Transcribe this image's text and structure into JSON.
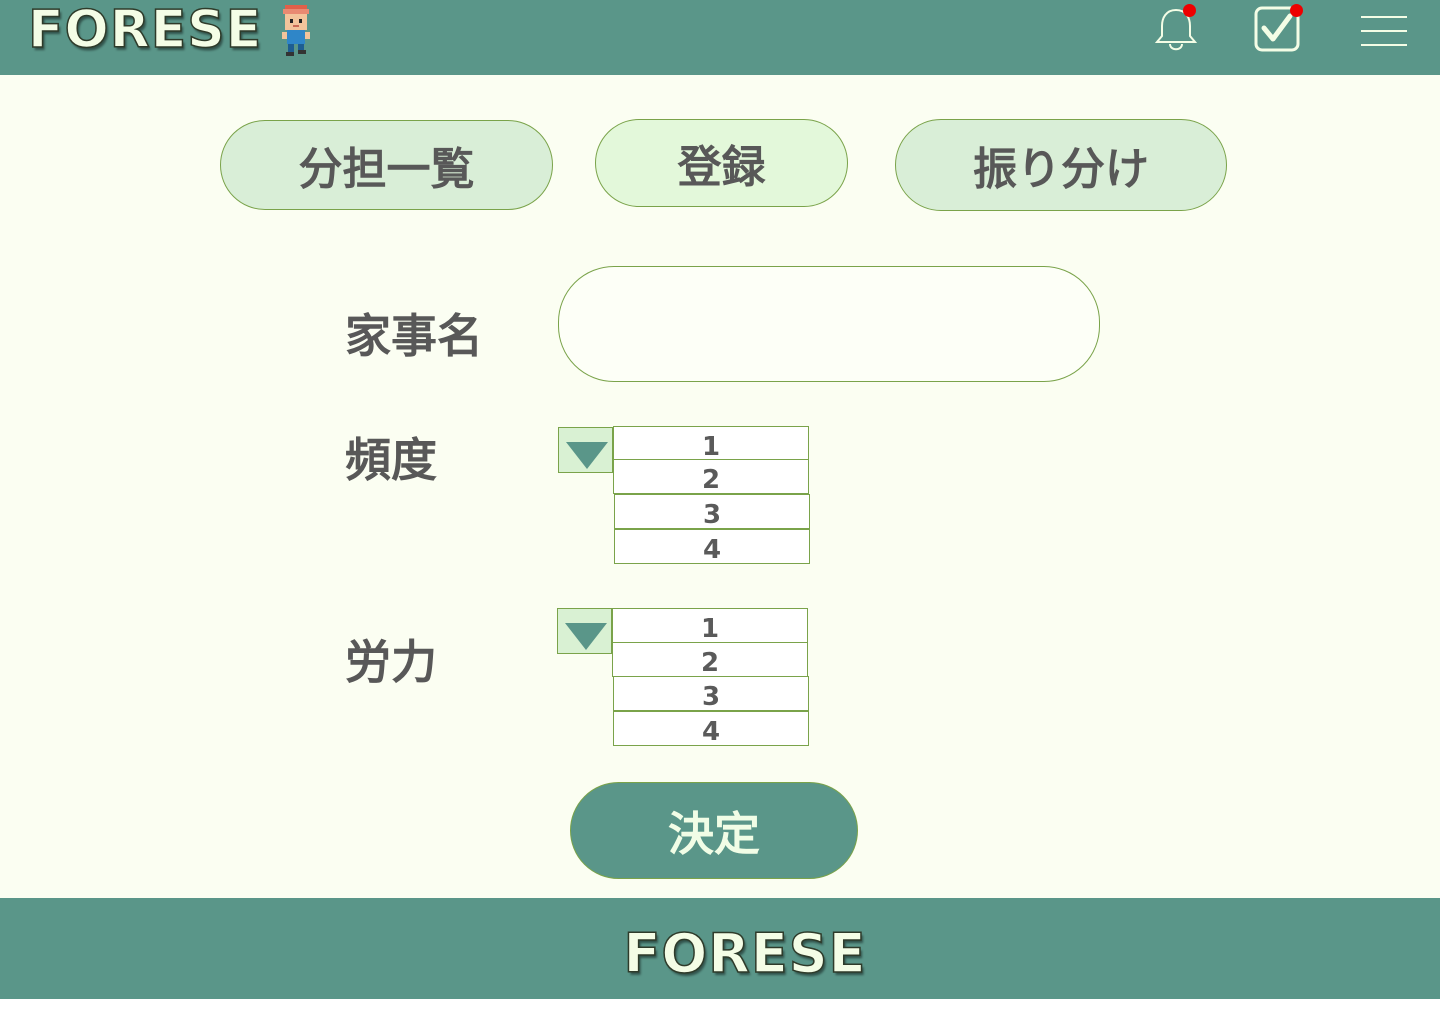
{
  "header": {
    "logo_text": "FORESE",
    "icons": [
      "bell-icon",
      "checkbox-icon",
      "hamburger-menu-icon"
    ],
    "notification_dot_color": "#ee0000"
  },
  "tabs": [
    {
      "label": "分担一覧"
    },
    {
      "label": "登録"
    },
    {
      "label": "振り分け"
    }
  ],
  "form": {
    "name_label": "家事名",
    "name_value": "",
    "frequency_label": "頻度",
    "frequency_options": [
      "1",
      "2",
      "3",
      "4"
    ],
    "effort_label": "労力",
    "effort_options": [
      "1",
      "2",
      "3",
      "4"
    ],
    "submit_label": "決定"
  },
  "footer": {
    "logo_text": "FORESE"
  },
  "colors": {
    "primary": "#5a9689",
    "background": "#fbfef2",
    "tab_fill": "#d9eed7",
    "border": "#7aa34a",
    "text": "#585858"
  }
}
